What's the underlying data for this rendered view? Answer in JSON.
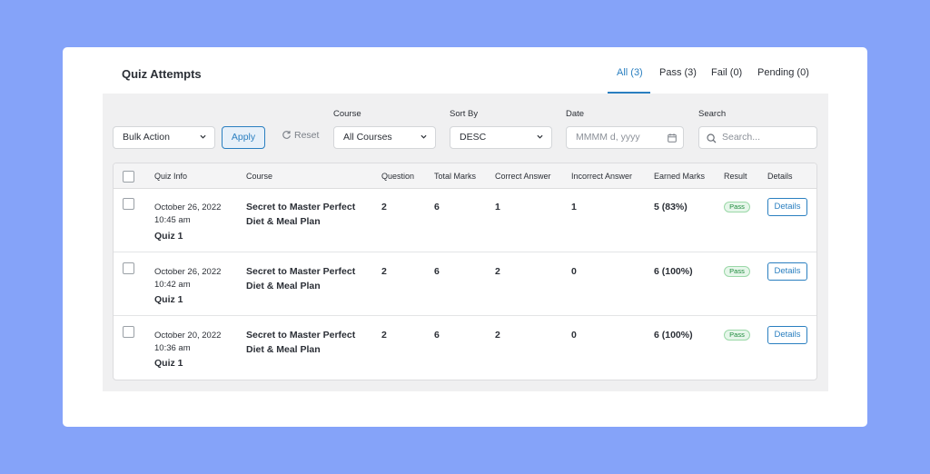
{
  "page": {
    "title": "Quiz Attempts"
  },
  "tabs": [
    {
      "label": "All (3)",
      "active": true
    },
    {
      "label": "Pass (3)",
      "active": false
    },
    {
      "label": "Fail (0)",
      "active": false
    },
    {
      "label": "Pending (0)",
      "active": false
    }
  ],
  "filters": {
    "bulk_action": "Bulk Action",
    "apply_label": "Apply",
    "reset_label": "Reset",
    "course_label": "Course",
    "course_value": "All Courses",
    "sort_label": "Sort By",
    "sort_value": "DESC",
    "date_label": "Date",
    "date_placeholder": "MMMM d, yyyy",
    "search_label": "Search",
    "search_placeholder": "Search..."
  },
  "table": {
    "columns": [
      "Quiz Info",
      "Course",
      "Question",
      "Total Marks",
      "Correct Answer",
      "Incorrect Answer",
      "Earned Marks",
      "Result",
      "Details"
    ],
    "rows": [
      {
        "date": "October 26, 2022",
        "time": "10:45 am",
        "quiz": "Quiz 1",
        "course_line1": "Secret to Master Perfect",
        "course_line2": "Diet & Meal Plan",
        "question": "2",
        "total": "6",
        "correct": "1",
        "incorrect": "1",
        "earned": "5 (83%)",
        "result": "Pass",
        "details": "Details"
      },
      {
        "date": "October 26, 2022",
        "time": "10:42 am",
        "quiz": "Quiz 1",
        "course_line1": "Secret to Master Perfect",
        "course_line2": "Diet & Meal Plan",
        "question": "2",
        "total": "6",
        "correct": "2",
        "incorrect": "0",
        "earned": "6 (100%)",
        "result": "Pass",
        "details": "Details"
      },
      {
        "date": "October 20, 2022",
        "time": "10:36 am",
        "quiz": "Quiz 1",
        "course_line1": "Secret to Master Perfect",
        "course_line2": "Diet & Meal Plan",
        "question": "2",
        "total": "6",
        "correct": "2",
        "incorrect": "0",
        "earned": "6 (100%)",
        "result": "Pass",
        "details": "Details"
      }
    ]
  },
  "colors": {
    "background": "#85a3f9",
    "accent": "#2a7fc0",
    "pass": "#1d8a3c"
  },
  "icons": [
    "chevron-down-icon",
    "reset-icon",
    "calendar-icon",
    "search-icon"
  ]
}
